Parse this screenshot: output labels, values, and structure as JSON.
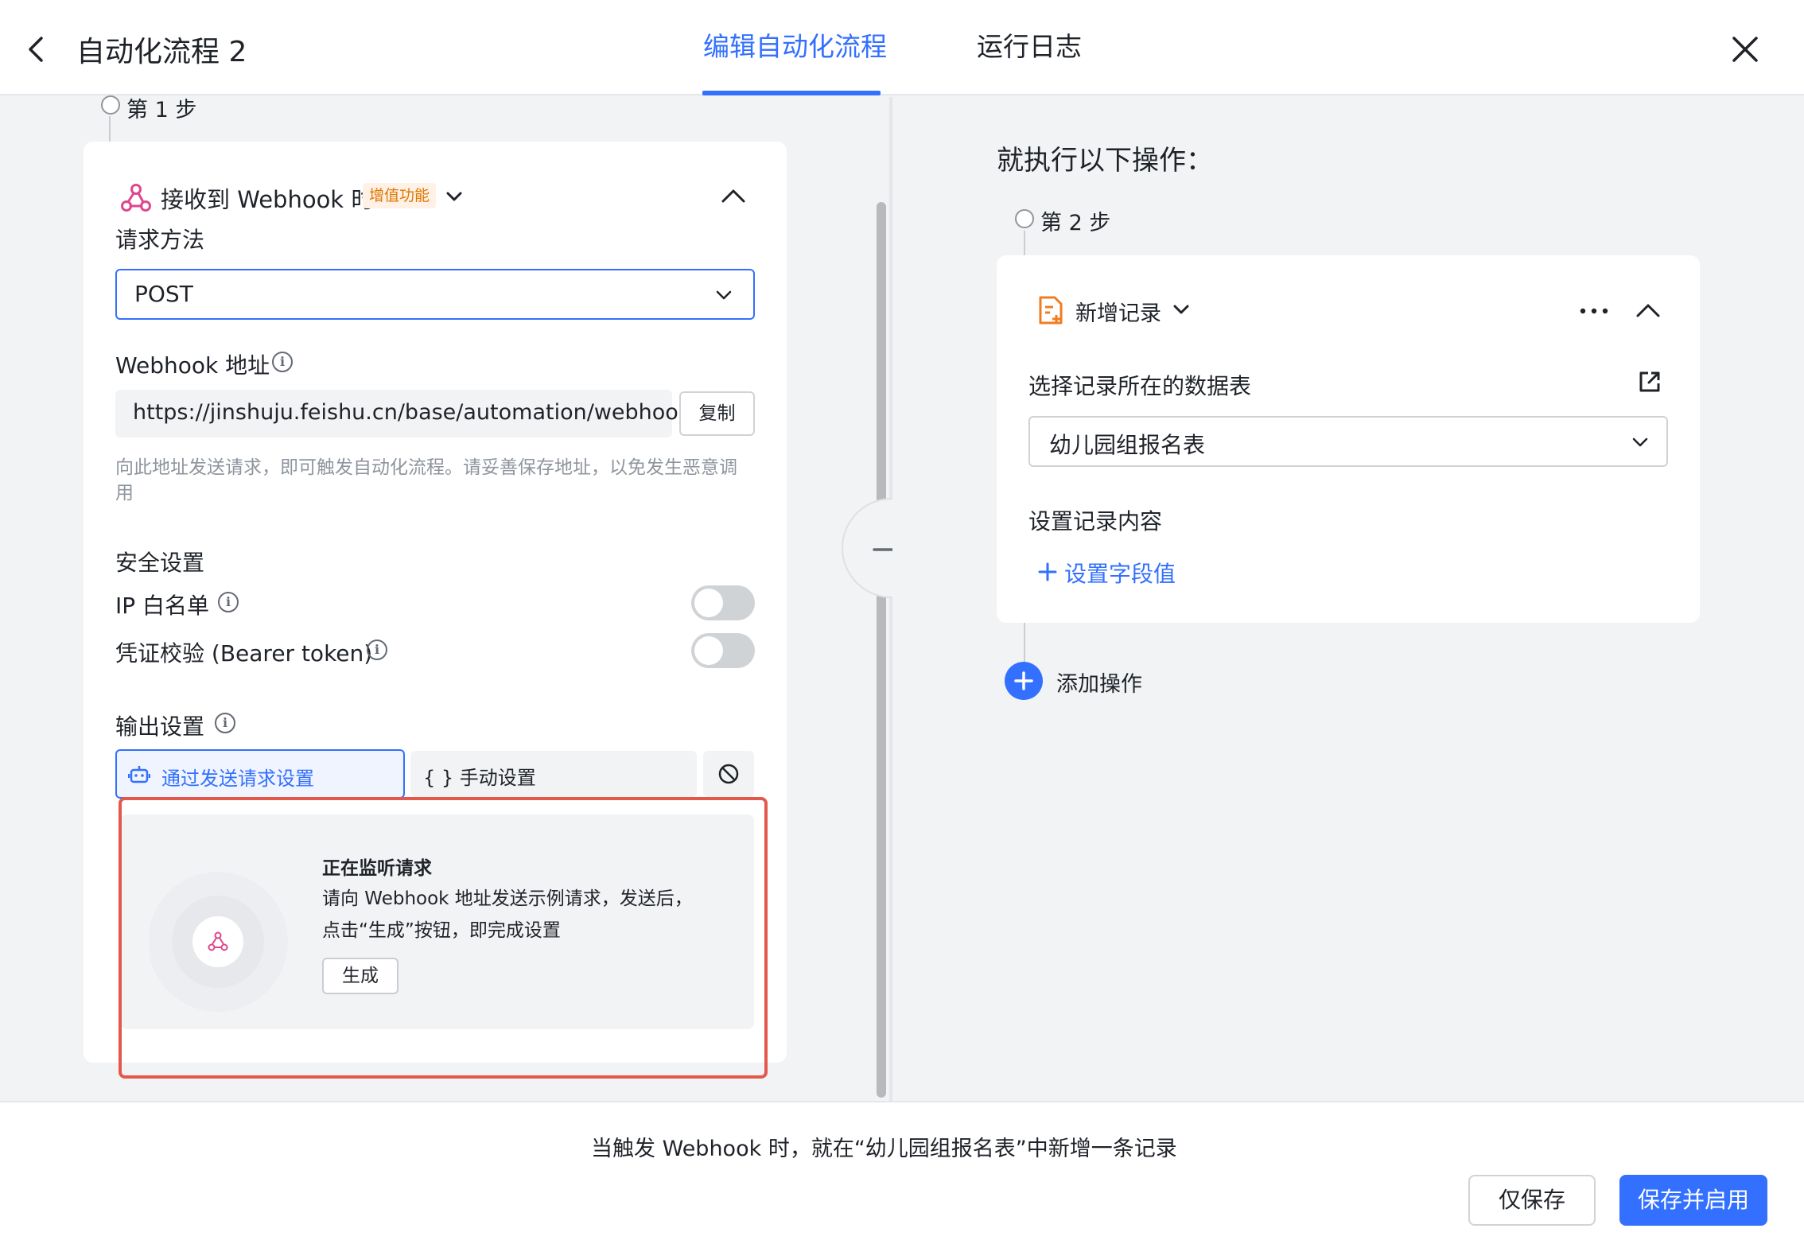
{
  "header": {
    "title": "自动化流程 2",
    "tabs": [
      {
        "label": "编辑自动化流程",
        "active": true
      },
      {
        "label": "运行日志",
        "active": false
      }
    ]
  },
  "trigger": {
    "step_label": "第 1 步",
    "title": "接收到 Webhook 时",
    "badge": "增值功能",
    "request_method": {
      "label": "请求方法",
      "value": "POST"
    },
    "webhook_url": {
      "label": "Webhook 地址",
      "value": "https://jinshuju.feishu.cn/base/automation/webhook",
      "copy_label": "复制",
      "hint": "向此地址发送请求，即可触发自动化流程。请妥善保存地址，以免发生恶意调用"
    },
    "security": {
      "title": "安全设置",
      "ip_whitelist": {
        "label": "IP 白名单",
        "enabled": false
      },
      "bearer": {
        "label": "凭证校验 (Bearer token)",
        "enabled": false
      }
    },
    "output": {
      "title": "输出设置",
      "options": [
        "通过发送请求设置",
        "{ } 手动设置"
      ],
      "selected": "通过发送请求设置"
    },
    "listening": {
      "title": "正在监听请求",
      "line1": "请向 Webhook 地址发送示例请求，发送后，",
      "line2": "点击“生成”按钮，即完成设置",
      "button": "生成"
    }
  },
  "actions": {
    "section_title": "就执行以下操作：",
    "step_label": "第 2 步",
    "action_title": "新增记录",
    "table_select": {
      "label": "选择记录所在的数据表",
      "value": "幼儿园组报名表"
    },
    "record_content": {
      "label": "设置记录内容",
      "add_field": "设置字段值"
    },
    "add_operation": "添加操作"
  },
  "footer": {
    "summary": "当触发 Webhook 时，就在“幼儿园组报名表”中新增一条记录",
    "save_only": "仅保存",
    "save_enable": "保存并启用"
  },
  "colors": {
    "accent": "#3370ff",
    "badge_text": "#de7802",
    "highlight": "#e4584c",
    "webhook_icon": "#e0468c",
    "record_icon": "#f07c20"
  }
}
